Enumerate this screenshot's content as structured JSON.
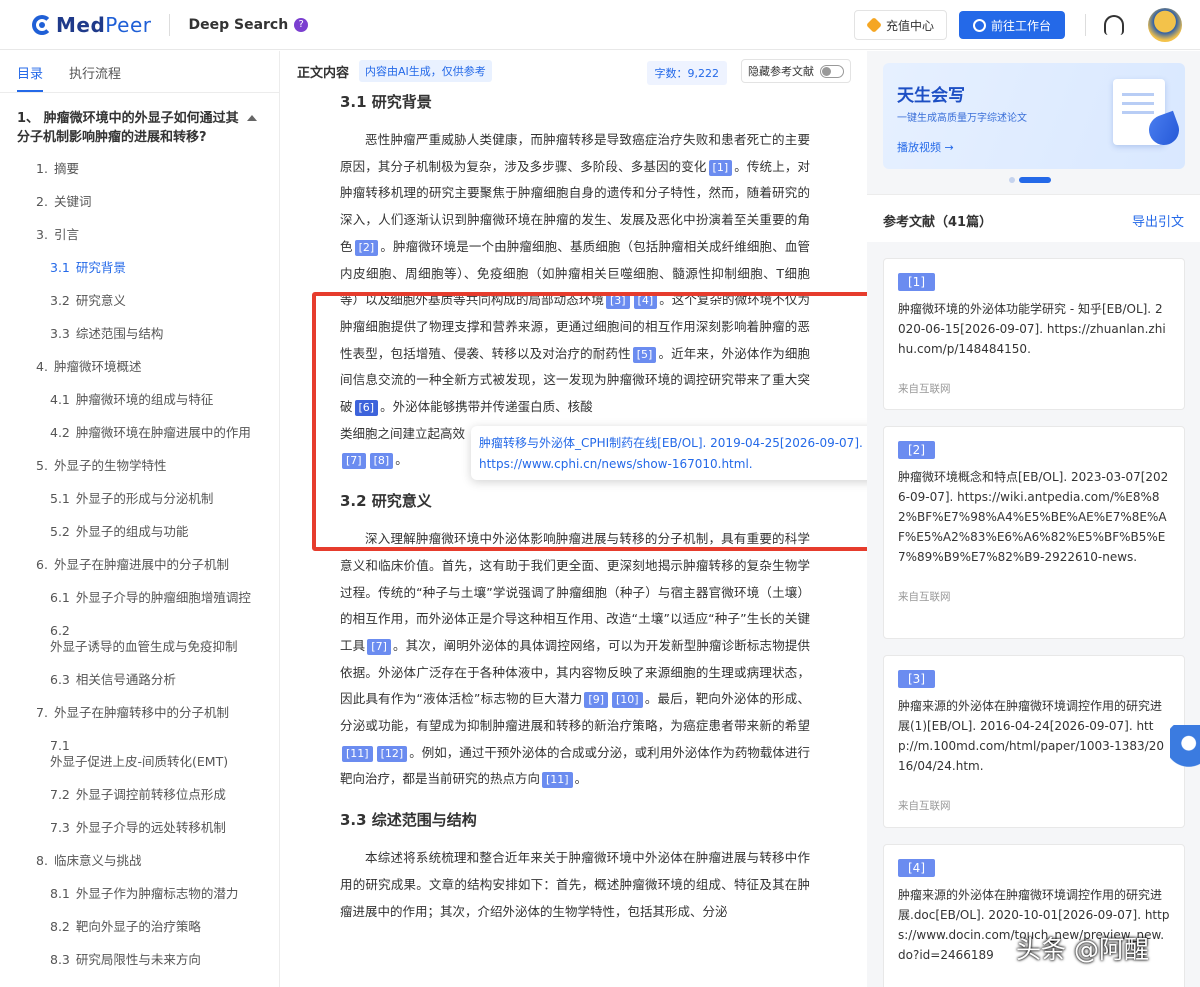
{
  "header": {
    "logo_main": "Med",
    "logo_accent": "Peer",
    "product": "Deep Search",
    "help": "?",
    "recharge_label": "充值中心",
    "workbench_label": "前往工作台"
  },
  "toc": {
    "tabs": [
      "目录",
      "执行流程"
    ],
    "question": "1、 肿瘤微环境中的外显子如何通过其分子机制影响肿瘤的进展和转移?",
    "items": [
      {
        "num": "1.",
        "label": "摘要"
      },
      {
        "num": "2.",
        "label": "关键词"
      },
      {
        "num": "3.",
        "label": "引言"
      },
      {
        "num": "3.1",
        "label": "研究背景"
      },
      {
        "num": "3.2",
        "label": "研究意义"
      },
      {
        "num": "3.3",
        "label": "综述范围与结构"
      },
      {
        "num": "4.",
        "label": "肿瘤微环境概述"
      },
      {
        "num": "4.1",
        "label": "肿瘤微环境的组成与特征"
      },
      {
        "num": "4.2",
        "label": "肿瘤微环境在肿瘤进展中的作用"
      },
      {
        "num": "5.",
        "label": "外显子的生物学特性"
      },
      {
        "num": "5.1",
        "label": "外显子的形成与分泌机制"
      },
      {
        "num": "5.2",
        "label": "外显子的组成与功能"
      },
      {
        "num": "6.",
        "label": "外显子在肿瘤进展中的分子机制"
      },
      {
        "num": "6.1",
        "label": "外显子介导的肿瘤细胞增殖调控"
      },
      {
        "num": "6.2",
        "label": "外显子诱导的血管生成与免疫抑制"
      },
      {
        "num": "6.3",
        "label": "相关信号通路分析"
      },
      {
        "num": "7.",
        "label": "外显子在肿瘤转移中的分子机制"
      },
      {
        "num": "7.1",
        "label": "外显子促进上皮-间质转化(EMT)"
      },
      {
        "num": "7.2",
        "label": "外显子调控前转移位点形成"
      },
      {
        "num": "7.3",
        "label": "外显子介导的远处转移机制"
      },
      {
        "num": "8.",
        "label": "临床意义与挑战"
      },
      {
        "num": "8.1",
        "label": "外显子作为肿瘤标志物的潜力"
      },
      {
        "num": "8.2",
        "label": "靶向外显子的治疗策略"
      },
      {
        "num": "8.3",
        "label": "研究局限性与未来方向"
      }
    ]
  },
  "main": {
    "title": "正文内容",
    "ai_tag": "内容由AI生成，仅供参考",
    "word_count": "字数：9,222",
    "hide_refs_label": "隐藏参考文献",
    "sec31_title": "3.1 研究背景",
    "sec32_title": "3.2 研究意义",
    "sec33_title": "3.3 综述范围与结构",
    "p1_a": "恶性肿瘤严重威胁人类健康，而肿瘤转移是导致癌症治疗失败和患者死亡的主要原因，其分子机制极为复杂，涉及多步骤、多阶段、多基因的变化",
    "p1_b": "。传统上，对肿瘤转移机理的研究主要聚焦于肿瘤细胞自身的遗传和分子特性，然而，随着研究的深入，人们逐渐认识到肿瘤微环境在肿瘤的发生、发展及恶化中扮演着至关重要的角色",
    "p1_c": "。肿瘤微环境是一个由肿瘤细胞、基质细胞（包括肿瘤相关成纤维细胞、血管内皮细胞、周细胞等）、免疫细胞（如肿瘤相关巨噬细胞、髓源性抑制细胞、T细胞等）以及细胞外基质等共同构成的局部动态环境",
    "p1_d": "。这个复杂的微环境不仅为肿瘤细胞提供了物理支撑和营养来源，更通过细胞间的相互作用深刻影响着肿瘤的恶性表型，包括增殖、侵袭、转移以及对治疗的耐药性",
    "p1_e": "。近年来，外泌体作为细胞间信息交流的一种全新方式被发现，这一发现为肿瘤微环境的调控研究带来了重大突破",
    "p1_f": "。外泌体能够携带并传递蛋白质、核酸",
    "p1_g": "类细胞之间建立起高效",
    "p1_h": "。",
    "p2_a": "深入理解肿瘤微环境中外泌体影响肿瘤进展与转移的分子机制，具有重要的科学意义和临床价值。首先，这有助于我们更全面、更深刻地揭示肿瘤转移的复杂生物学过程。传统的“种子与土壤”学说强调了肿瘤细胞（种子）与宿主器官微环境（土壤）的相互作用，而外泌体正是介导这种相互作用、改造“土壤”以适应“种子”生长的关键工具",
    "p2_b": "。其次，阐明外泌体的具体调控网络，可以为开发新型肿瘤诊断标志物提供依据。外泌体广泛存在于各种体液中，其内容物反映了来源细胞的生理或病理状态，因此具有作为“液体活检”标志物的巨大潜力",
    "p2_c": "。最后，靶向外泌体的形成、分泌或功能，有望成为抑制肿瘤进展和转移的新治疗策略，为癌症患者带来新的希望",
    "p2_d": "。例如，通过干预外泌体的合成或分泌，或利用外泌体作为药物载体进行靶向治疗，都是当前研究的热点方向",
    "p2_e": "。",
    "p3": "本综述将系统梳理和整合近年来关于肿瘤微环境中外泌体在肿瘤进展与转移中作用的研究成果。文章的结构安排如下：首先，概述肿瘤微环境的组成、特征及其在肿瘤进展中的作用；其次，介绍外泌体的生物学特性，包括其形成、分泌",
    "refs": {
      "r1": "[1]",
      "r2": "[2]",
      "r3": "[3]",
      "r4": "[4]",
      "r5": "[5]",
      "r6": "[6]",
      "r7": "[7]",
      "r8": "[8]",
      "r9": "[9]",
      "r10": "[10]",
      "r11": "[11]",
      "r12": "[12]"
    },
    "tooltip_line1": "肿瘤转移与外泌体_CPHI制药在线[EB/OL]. 2019-04-25[2026-09-07].",
    "tooltip_line2": "https://www.cphi.cn/news/show-167010.html."
  },
  "right": {
    "banner_title": "天生会写",
    "banner_sub": "一键生成高质量万字综述论文",
    "banner_link": "播放视频 →",
    "refs_title": "参考文献（41篇）",
    "export_label": "导出引文",
    "ref_cards": [
      {
        "num": "[1]",
        "text": "肿瘤微环境的外泌体功能学研究 - 知乎[EB/OL]. 2020-06-15[2026-09-07]. https://zhuanlan.zhihu.com/p/148484150.",
        "source": "来自互联网"
      },
      {
        "num": "[2]",
        "text": "肿瘤微环境概念和特点[EB/OL]. 2023-03-07[2026-09-07]. https://wiki.antpedia.com/%E8%82%BF%E7%98%A4%E5%BE%AE%E7%8E%AF%E5%A2%83%E6%A6%82%E5%BF%B5%E7%89%B9%E7%82%B9-2922610-news.",
        "source": "来自互联网"
      },
      {
        "num": "[3]",
        "text": "肿瘤来源的外泌体在肿瘤微环境调控作用的研究进展(1)[EB/OL]. 2016-04-24[2026-09-07]. http://m.100md.com/html/paper/1003-1383/2016/04/24.htm.",
        "source": "来自互联网"
      },
      {
        "num": "[4]",
        "text": "肿瘤来源的外泌体在肿瘤微环境调控作用的研究进展.doc[EB/OL]. 2020-10-01[2026-09-07]. https://www.docin.com/touch_new/preview_new.do?id=2466189",
        "source": ""
      }
    ]
  },
  "watermark": "头条 @阿醒"
}
